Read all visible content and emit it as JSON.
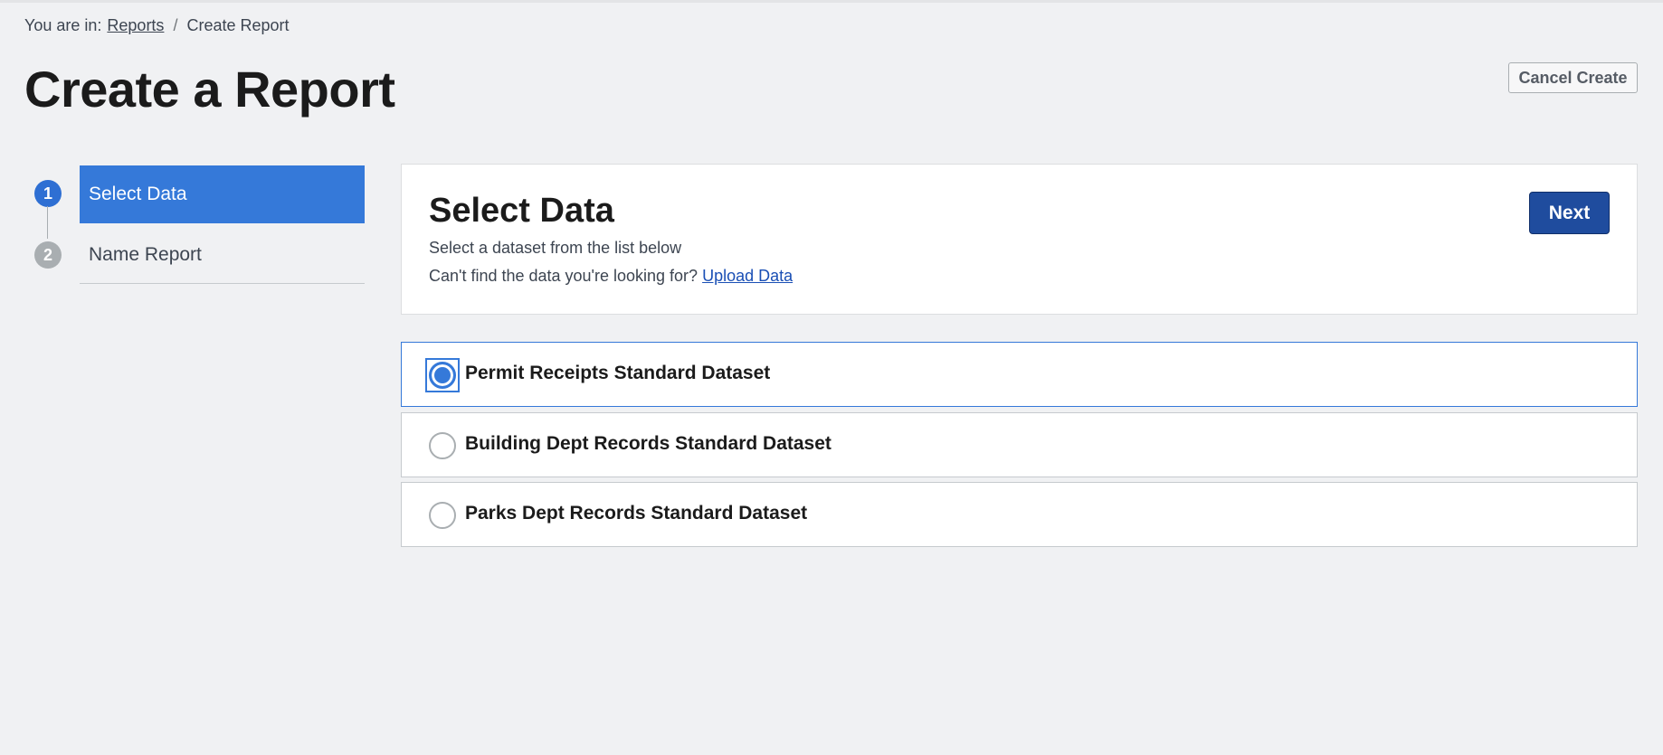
{
  "breadcrumb": {
    "prefix": "You are in:",
    "link": "Reports",
    "separator": "/",
    "current": "Create Report"
  },
  "page": {
    "title": "Create a Report",
    "cancel_label": "Cancel Create"
  },
  "steps": [
    {
      "number": "1",
      "label": "Select Data",
      "active": true
    },
    {
      "number": "2",
      "label": "Name Report",
      "active": false
    }
  ],
  "card": {
    "title": "Select Data",
    "subtitle": "Select a dataset from the list below",
    "help_text": "Can't find the data you're looking for?",
    "help_link": "Upload Data",
    "next_label": "Next"
  },
  "datasets": [
    {
      "label": "Permit Receipts Standard Dataset",
      "selected": true
    },
    {
      "label": "Building Dept Records Standard Dataset",
      "selected": false
    },
    {
      "label": "Parks Dept Records Standard Dataset",
      "selected": false
    }
  ],
  "colors": {
    "accent": "#3579d9",
    "primary_button": "#1f4c9e",
    "background": "#f0f1f3"
  }
}
